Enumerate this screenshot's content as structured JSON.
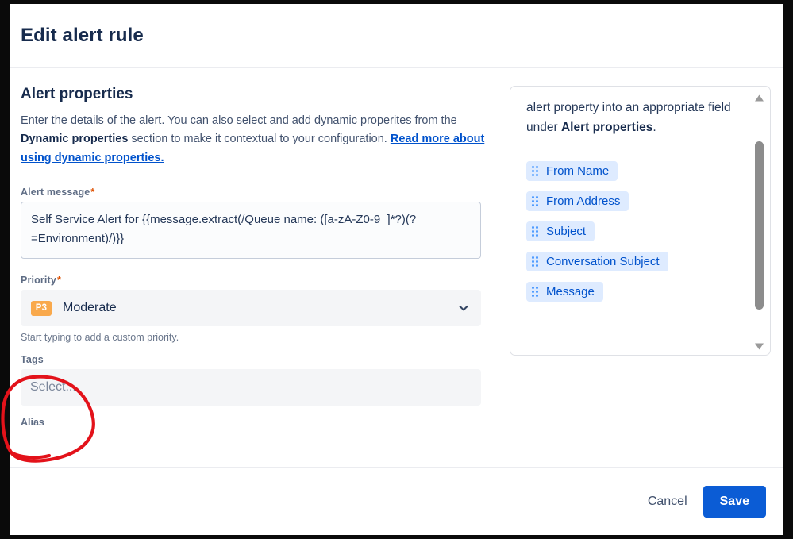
{
  "dialog": {
    "title": "Edit alert rule"
  },
  "alert_properties": {
    "section_title": "Alert properties",
    "description_part1": "Enter the details of the alert. You can also select and add dynamic properites from the ",
    "description_bold": "Dynamic properties",
    "description_part2": " section to make it contextual to your configuration. ",
    "description_link": "Read more about using dynamic properties.",
    "alert_message": {
      "label": "Alert message",
      "required_marker": "*",
      "value": "Self Service Alert for {{message.extract(/Queue name: ([a-zA-Z0-9_]*?)(?=Environment)/)}}"
    },
    "priority": {
      "label": "Priority",
      "required_marker": "*",
      "badge": "P3",
      "selected": "Moderate",
      "badge_color": "#f9a94c",
      "help_text": "Start typing to add a custom priority.",
      "chevron_icon": "chevron-down-icon"
    },
    "tags": {
      "label": "Tags",
      "placeholder": "Select..."
    },
    "alias": {
      "label": "Alias"
    }
  },
  "dynamic_properties_panel": {
    "text_part1": "alert property into an appropriate field under ",
    "text_bold": "Alert properties",
    "text_part2": ".",
    "chips": [
      {
        "label": "From Name",
        "icon": "drag-handle-icon"
      },
      {
        "label": "From Address",
        "icon": "drag-handle-icon"
      },
      {
        "label": "Subject",
        "icon": "drag-handle-icon"
      },
      {
        "label": "Conversation Subject",
        "icon": "drag-handle-icon"
      },
      {
        "label": "Message",
        "icon": "drag-handle-icon"
      }
    ],
    "scrollbar": {
      "up_icon": "scroll-up-arrow-icon",
      "down_icon": "scroll-down-arrow-icon"
    }
  },
  "footer": {
    "cancel_label": "Cancel",
    "save_label": "Save",
    "save_color": "#0b5cd5"
  },
  "annotation": {
    "type": "hand-drawn-circle",
    "color": "#e3121a",
    "target": "tags-field"
  }
}
